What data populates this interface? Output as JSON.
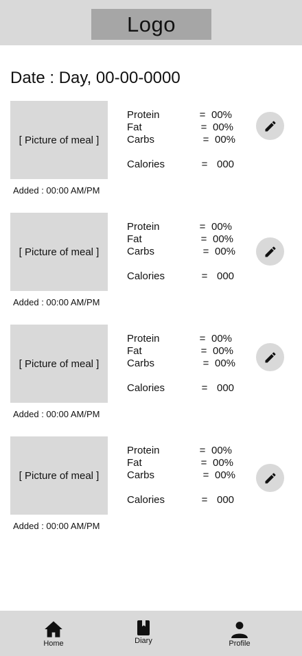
{
  "header": {
    "logo": "Logo"
  },
  "date_line": "Date : Day, 00-00-0000",
  "meals": [
    {
      "picture": "[ Picture of meal ]",
      "added": "Added : 00:00 AM/PM",
      "protein_label": "Protein",
      "protein_value": "00%",
      "fat_label": "Fat",
      "fat_value": "00%",
      "carbs_label": "Carbs",
      "carbs_value": "00%",
      "calories_label": "Calories",
      "calories_value": "000",
      "eq": "="
    },
    {
      "picture": "[ Picture of meal ]",
      "added": "Added : 00:00 AM/PM",
      "protein_label": "Protein",
      "protein_value": "00%",
      "fat_label": "Fat",
      "fat_value": "00%",
      "carbs_label": "Carbs",
      "carbs_value": "00%",
      "calories_label": "Calories",
      "calories_value": "000",
      "eq": "="
    },
    {
      "picture": "[ Picture of meal ]",
      "added": "Added : 00:00 AM/PM",
      "protein_label": "Protein",
      "protein_value": "00%",
      "fat_label": "Fat",
      "fat_value": "00%",
      "carbs_label": "Carbs",
      "carbs_value": "00%",
      "calories_label": "Calories",
      "calories_value": "000",
      "eq": "="
    },
    {
      "picture": "[ Picture of meal ]",
      "added": "Added : 00:00 AM/PM",
      "protein_label": "Protein",
      "protein_value": "00%",
      "fat_label": "Fat",
      "fat_value": "00%",
      "carbs_label": "Carbs",
      "carbs_value": "00%",
      "calories_label": "Calories",
      "calories_value": "000",
      "eq": "="
    }
  ],
  "nav": {
    "home": {
      "label": "Home",
      "icon": "home-icon"
    },
    "diary": {
      "label": "Diary",
      "icon": "diary-icon"
    },
    "profile": {
      "label": "Profile",
      "icon": "person-icon"
    }
  },
  "colors": {
    "panel": "#d9d9d9",
    "logo_bg": "#a6a6a6",
    "text": "#111111"
  }
}
